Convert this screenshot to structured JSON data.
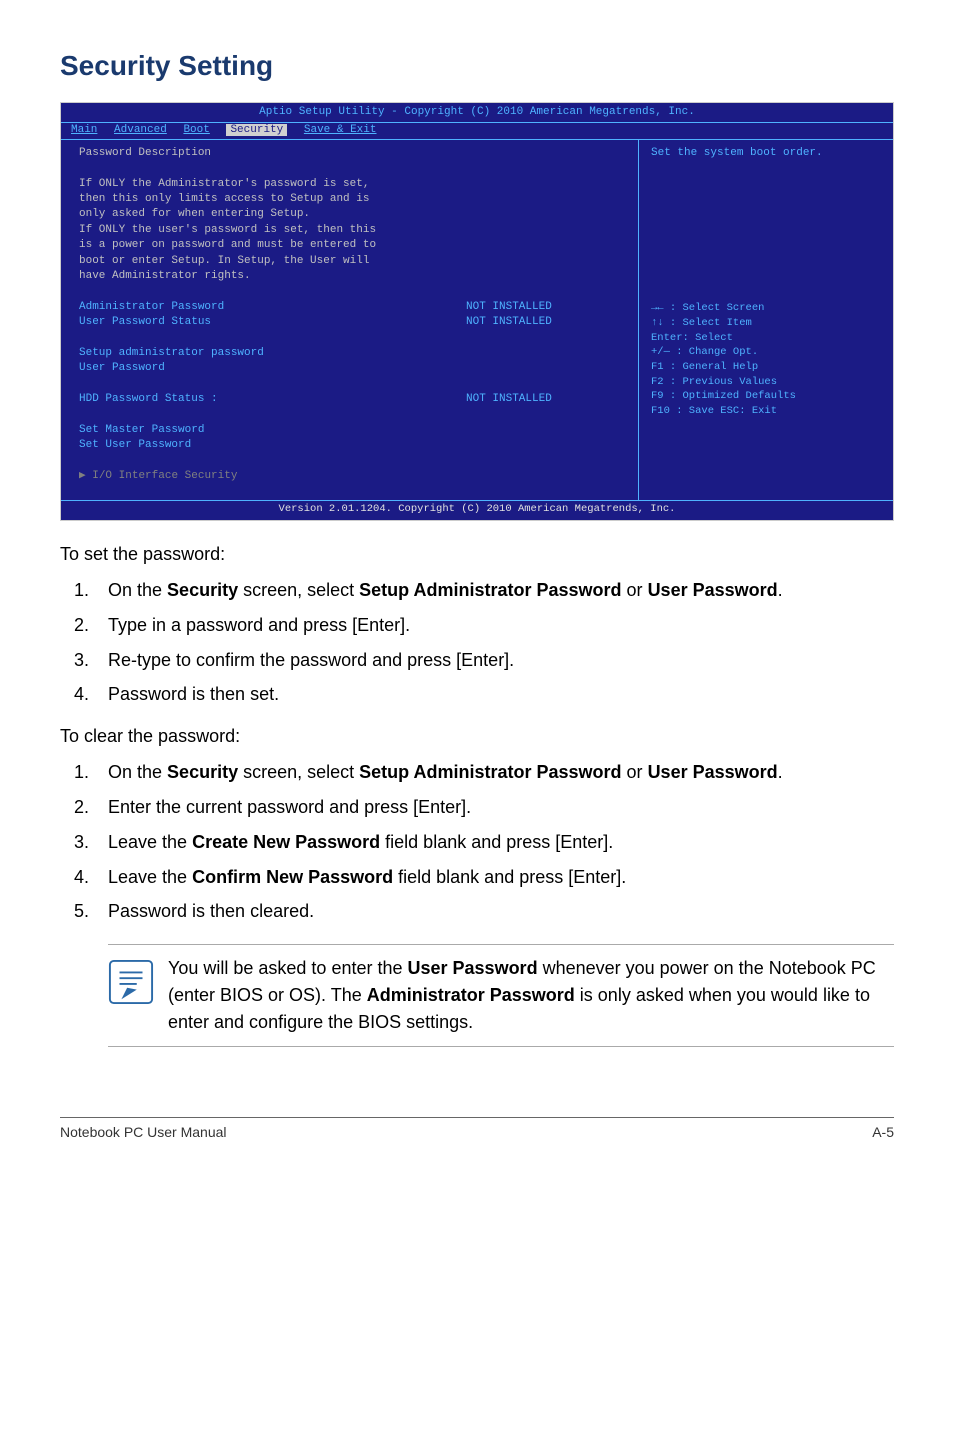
{
  "heading": "Security Setting",
  "bios": {
    "titlebar": "Aptio Setup Utility - Copyright (C) 2010 American Megatrends, Inc.",
    "tabs": [
      "Main",
      "Advanced",
      "Boot",
      "Security",
      "Save & Exit"
    ],
    "active_tab": "Security",
    "desc_header": "Password Description",
    "desc_lines": [
      "If ONLY the Administrator's password is set,",
      "then this only limits access to Setup and is",
      "only asked for when entering Setup.",
      "If ONLY the user's password is set, then this",
      "is a power on password and must be entered to",
      "boot or enter Setup. In Setup, the User will",
      "have Administrator rights."
    ],
    "rows": [
      {
        "label": "Administrator Password",
        "value": "NOT INSTALLED"
      },
      {
        "label": "User Password Status",
        "value": "NOT INSTALLED"
      }
    ],
    "sub_items": [
      "Setup administrator password",
      "User Password"
    ],
    "hdd_row": {
      "label": "HDD Password Status :",
      "value": "NOT INSTALLED"
    },
    "set_items": [
      "Set Master Password",
      "Set User Password"
    ],
    "submenu": "I/O Interface Security",
    "right_help_top": "Set the system boot order.",
    "help_lines": [
      "→← : Select Screen",
      "↑↓ :   Select Item",
      "Enter: Select",
      "+/— :  Change Opt.",
      "F1 :   General Help",
      "F2 :   Previous Values",
      "F9 :   Optimized Defaults",
      "F10 :  Save   ESC: Exit"
    ],
    "footer": "Version 2.01.1204. Copyright (C) 2010 American Megatrends, Inc."
  },
  "set_pw_intro": "To set the password:",
  "set_pw_steps": [
    "On the <b>Security</b> screen, select <b>Setup Administrator Password</b> or <b>User Password</b>.",
    "Type in a password and press [Enter].",
    "Re-type to confirm the password and press [Enter].",
    "Password is then set."
  ],
  "clear_pw_intro": "To clear the password:",
  "clear_pw_steps": [
    "On the <b>Security</b> screen, select <b>Setup Administrator Password</b> or <b>User Password</b>.",
    "Enter the current password and press [Enter].",
    "Leave the <b>Create New Password</b> field blank and press [Enter].",
    "Leave the <b>Confirm New Password</b> field blank and press [Enter].",
    "Password is then cleared."
  ],
  "note": "You will be asked to enter the <b>User Password</b> whenever you power on the Notebook PC (enter BIOS or OS). The <b>Administrator Password</b> is only asked when you would like to enter and configure the BIOS settings.",
  "footer_left": "Notebook PC User Manual",
  "footer_right": "A-5"
}
